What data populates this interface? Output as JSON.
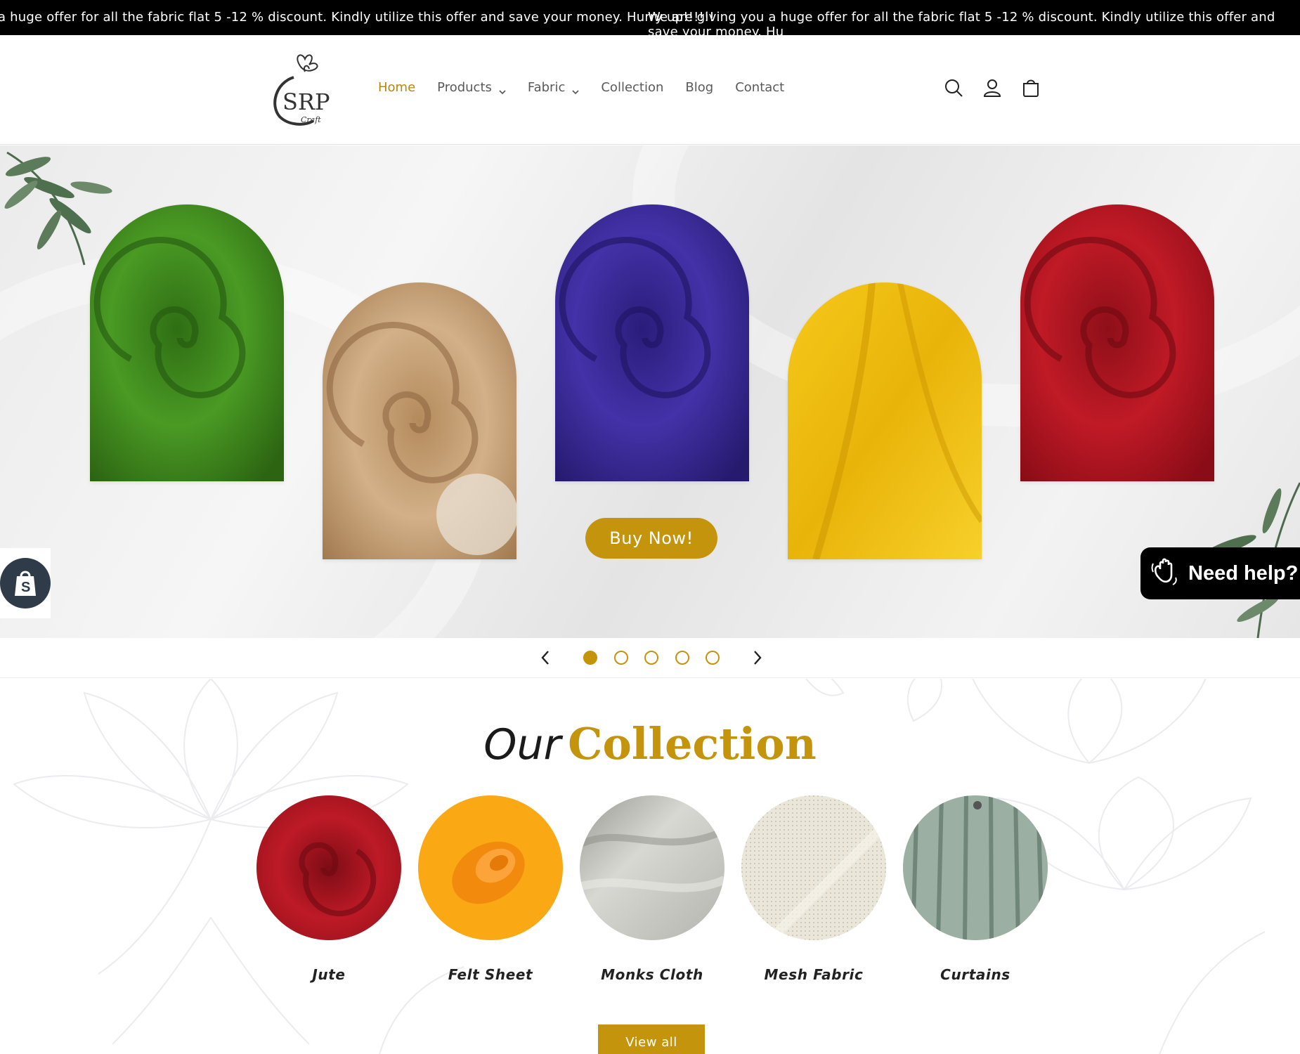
{
  "announcement": {
    "message_partial": "a huge offer for all the fabric flat 5 -12 % discount. Kindly utilize this offer and save your money. Hurry up!!!!!!",
    "message_full": "We are giving you a huge offer for all the fabric flat 5 -12 % discount. Kindly utilize this offer and save your money. Hu"
  },
  "header": {
    "logo": {
      "text_main": "SRP",
      "text_sub": "Craft"
    },
    "nav": [
      {
        "label": "Home",
        "active": true,
        "dropdown": false
      },
      {
        "label": "Products",
        "active": false,
        "dropdown": true
      },
      {
        "label": "Fabric",
        "active": false,
        "dropdown": true
      },
      {
        "label": "Collection",
        "active": false,
        "dropdown": false
      },
      {
        "label": "Blog",
        "active": false,
        "dropdown": false
      },
      {
        "label": "Contact",
        "active": false,
        "dropdown": false
      }
    ],
    "icons": [
      "search-icon",
      "account-icon",
      "cart-icon"
    ]
  },
  "hero": {
    "fabrics": [
      {
        "color": "#3d8a1f",
        "name": "green-fabric"
      },
      {
        "color": "#c9a47a",
        "name": "jute-fabric"
      },
      {
        "color": "#3a2a96",
        "name": "purple-fabric"
      },
      {
        "color": "#f0c112",
        "name": "yellow-fabric"
      },
      {
        "color": "#b3131f",
        "name": "red-fabric"
      }
    ],
    "cta_label": "Buy Now!"
  },
  "slider": {
    "slide_count": 5,
    "active_slide": 1
  },
  "help_widget": {
    "label": "Need help?"
  },
  "collection": {
    "title_italic": "Our",
    "title_bold": "Collection",
    "categories": [
      {
        "label": "Jute",
        "color": "#b3131f"
      },
      {
        "label": "Felt Sheet",
        "color": "#f7a012"
      },
      {
        "label": "Monks Cloth",
        "color": "#c7c7c2"
      },
      {
        "label": "Mesh Fabric",
        "color": "#e8e4d8"
      },
      {
        "label": "Curtains",
        "color": "#8fa598"
      }
    ],
    "view_all_label": "View all"
  },
  "colors": {
    "accent": "#c4940c",
    "announcement_bg": "#000000",
    "shopify_badge": "#2f3b48"
  }
}
